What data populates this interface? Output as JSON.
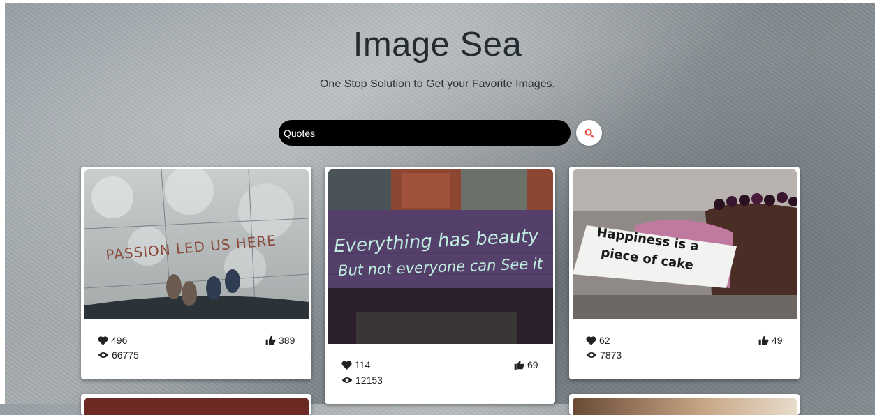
{
  "header": {
    "title": "Image Sea",
    "subtitle": "One Stop Solution to Get your Favorite Images."
  },
  "search": {
    "value": "Quotes",
    "button_icon": "search-icon"
  },
  "cards": [
    {
      "image_text": "PASSION LED US HERE",
      "likes": "496",
      "thumbs": "389",
      "views": "66775"
    },
    {
      "image_text_line1": "Everything has beauty",
      "image_text_line2": "But not everyone can See it",
      "likes": "114",
      "thumbs": "69",
      "views": "12153"
    },
    {
      "image_text_line1": "Happiness is a",
      "image_text_line2": "piece of cake",
      "likes": "62",
      "thumbs": "49",
      "views": "7873"
    }
  ],
  "icons": {
    "like": "heart-icon",
    "thumb": "thumbs-up-icon",
    "view": "eye-icon"
  },
  "colors": {
    "search_icon": "#e04a3a",
    "search_bar": "#000000"
  }
}
